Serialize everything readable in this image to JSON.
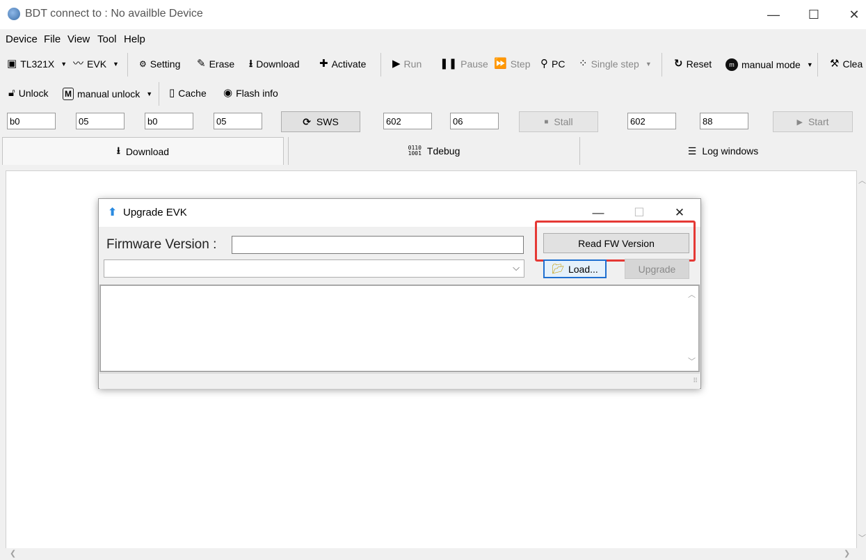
{
  "window": {
    "title": "BDT connect to : No availble Device",
    "minimize": "—",
    "maximize": "☐",
    "close": "✕"
  },
  "menu": [
    "Device",
    "File",
    "View",
    "Tool",
    "Help"
  ],
  "toolbar1": {
    "chip": "TL321X",
    "board": "EVK",
    "setting": "Setting",
    "erase": "Erase",
    "download": "Download",
    "activate": "Activate",
    "run": "Run",
    "pause": "Pause",
    "step": "Step",
    "pc": "PC",
    "single_step": "Single step",
    "reset": "Reset",
    "mode": "manual mode",
    "clear": "Clea"
  },
  "toolbar2": {
    "unlock": "Unlock",
    "manual_unlock": "manual unlock",
    "cache": "Cache",
    "flash_info": "Flash info"
  },
  "inputs_row": {
    "field1": "b0",
    "field2": "05",
    "field3": "b0",
    "field4": "05",
    "sws_label": "SWS",
    "field5": "602",
    "field6": "06",
    "stall_label": "Stall",
    "field7": "602",
    "field8": "88",
    "start_label": "Start"
  },
  "tabs": {
    "download": "Download",
    "tdebug": "Tdebug",
    "log": "Log windows"
  },
  "dialog": {
    "title": "Upgrade EVK",
    "firmware_label": "Firmware Version :",
    "firmware_value": "",
    "file_select_value": "",
    "read_fw_label": "Read FW Version",
    "load_label": "Load...",
    "upgrade_label": "Upgrade",
    "highlight_color": "#e53935"
  }
}
